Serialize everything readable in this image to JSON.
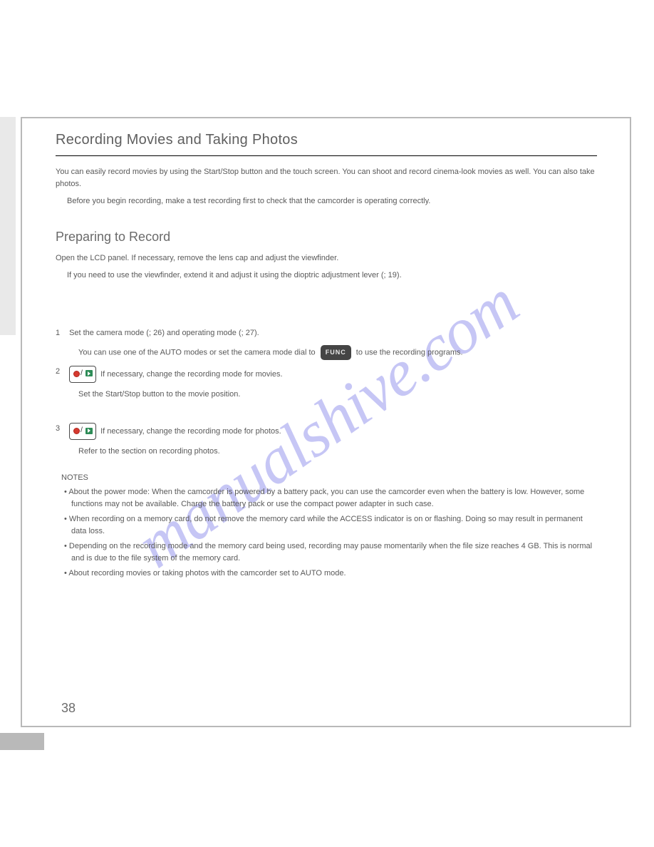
{
  "watermark": "manualshive.com",
  "page_number": "38",
  "section": {
    "title": "Recording Movies and Taking Photos"
  },
  "intro": {
    "p1": "You can easily record movies by using the Start/Stop button and the touch screen. You can shoot and record cinema-look movies as well. You can also take photos.",
    "p2": "Before you begin recording, make a test recording first to check that the camcorder is operating correctly."
  },
  "prep": {
    "heading": "Preparing to Record",
    "p1": "Open the LCD panel. If necessary, remove the lens cap and adjust the viewfinder.",
    "p2_a": "If you need to use the viewfinder, extend it and adjust it using the dioptric adjustment lever (",
    "p2_ref": "; 19",
    "p2_b": ")."
  },
  "steps": {
    "s1": {
      "num": "1",
      "a": "Set the camera mode (",
      "ref": "; 26",
      "b": ") and operating mode (",
      "ref2": "; 27",
      "c": ").",
      "sub_a": "You can use one of the AUTO modes or set the camera mode dial to ",
      "sub_func": "FUNC",
      "sub_b": " to use the recording programs."
    },
    "s2": {
      "num": "2",
      "a": "If necessary, change the recording mode for movies.",
      "sub": "Set the Start/Stop button to the movie position."
    },
    "s3": {
      "num": "3",
      "a": "If necessary, change the recording mode for photos.",
      "sub": "Refer to the section on recording photos."
    }
  },
  "notes": {
    "label": "NOTES",
    "n1": "About the power mode: When the camcorder is powered by a battery pack, you can use the camcorder even when the battery is low. However, some functions may not be available. Charge the battery pack or use the compact power adapter in such case.",
    "n2": "When recording on a memory card, do not remove the memory card while the ACCESS indicator is on or flashing. Doing so may result in permanent data loss.",
    "n3": "Depending on the recording mode and the memory card being used, recording may pause momentarily when the file size reaches 4 GB. This is normal and is due to the file system of the memory card.",
    "n4": "About recording movies or taking photos with the camcorder set to AUTO mode."
  }
}
